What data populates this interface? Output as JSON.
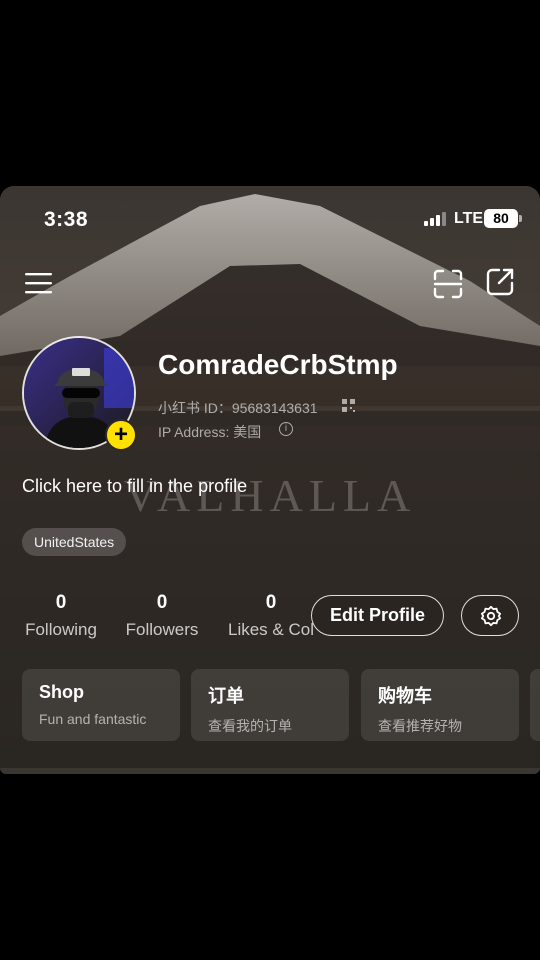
{
  "status_bar": {
    "time": "3:38",
    "network": "LTE",
    "battery": "80"
  },
  "nav": {
    "menu_icon": "hamburger-menu-icon",
    "scan_icon": "scan-icon",
    "share_icon": "share-icon"
  },
  "background_art": {
    "caption": "VALHALLA"
  },
  "profile": {
    "username": "ComradeCrbStmp",
    "user_id": "小红书 ID：95683143631",
    "ip_address": "IP Address: 美国",
    "prompt": "Click here to fill in the profile",
    "tag": "UnitedStates"
  },
  "stats": {
    "following": {
      "count": "0",
      "label": "Following"
    },
    "followers": {
      "count": "0",
      "label": "Followers"
    },
    "likes": {
      "count": "0",
      "label": "Likes & Col"
    }
  },
  "actions": {
    "edit_profile": "Edit Profile",
    "settings_icon": "gear-icon"
  },
  "cards": [
    {
      "title": "Shop",
      "subtitle": "Fun and fantastic"
    },
    {
      "title": "订单",
      "subtitle": "查看我的订单"
    },
    {
      "title": "购物车",
      "subtitle": "查看推荐好物"
    }
  ],
  "colors": {
    "accent_badge": "#ffe000",
    "background": "#2f2a25"
  }
}
